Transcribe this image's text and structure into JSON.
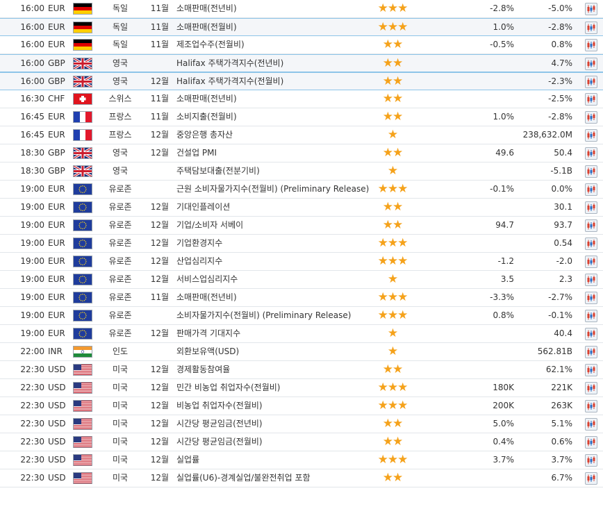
{
  "colors": {
    "star": "#f5a21b",
    "highlight_border": "#8dc4e8",
    "row_border": "#e2e6ea"
  },
  "star_glyph": "★",
  "chart_icon": "candlestick-chart-icon",
  "rows": [
    {
      "time": "16:00",
      "currency": "EUR",
      "flag": "de",
      "country": "독일",
      "period": "11월",
      "event": "소매판매(전년비)",
      "importance": 3,
      "forecast": "-2.8%",
      "previous": "-5.0%",
      "highlight": false
    },
    {
      "time": "16:00",
      "currency": "EUR",
      "flag": "de",
      "country": "독일",
      "period": "11월",
      "event": "소매판매(전월비)",
      "importance": 3,
      "forecast": "1.0%",
      "previous": "-2.8%",
      "highlight": true
    },
    {
      "time": "16:00",
      "currency": "EUR",
      "flag": "de",
      "country": "독일",
      "period": "11월",
      "event": "제조업수주(전월비)",
      "importance": 2,
      "forecast": "-0.5%",
      "previous": "0.8%",
      "highlight": false
    },
    {
      "time": "16:00",
      "currency": "GBP",
      "flag": "gb",
      "country": "영국",
      "period": "",
      "event": "Halifax 주택가격지수(전년비)",
      "importance": 2,
      "forecast": "",
      "previous": "4.7%",
      "highlight": true
    },
    {
      "time": "16:00",
      "currency": "GBP",
      "flag": "gb",
      "country": "영국",
      "period": "12월",
      "event": "Halifax 주택가격지수(전월비)",
      "importance": 2,
      "forecast": "",
      "previous": "-2.3%",
      "highlight": true
    },
    {
      "time": "16:30",
      "currency": "CHF",
      "flag": "ch",
      "country": "스위스",
      "period": "11월",
      "event": "소매판매(전년비)",
      "importance": 2,
      "forecast": "",
      "previous": "-2.5%",
      "highlight": false
    },
    {
      "time": "16:45",
      "currency": "EUR",
      "flag": "fr",
      "country": "프랑스",
      "period": "11월",
      "event": "소비지출(전월비)",
      "importance": 2,
      "forecast": "1.0%",
      "previous": "-2.8%",
      "highlight": false
    },
    {
      "time": "16:45",
      "currency": "EUR",
      "flag": "fr",
      "country": "프랑스",
      "period": "12월",
      "event": "중앙은행 총자산",
      "importance": 1,
      "forecast": "",
      "previous": "238,632.0M",
      "highlight": false
    },
    {
      "time": "18:30",
      "currency": "GBP",
      "flag": "gb",
      "country": "영국",
      "period": "12월",
      "event": "건설업 PMI",
      "importance": 2,
      "forecast": "49.6",
      "previous": "50.4",
      "highlight": false
    },
    {
      "time": "18:30",
      "currency": "GBP",
      "flag": "gb",
      "country": "영국",
      "period": "",
      "event": "주택담보대출(전분기비)",
      "importance": 1,
      "forecast": "",
      "previous": "-5.1B",
      "highlight": false
    },
    {
      "time": "19:00",
      "currency": "EUR",
      "flag": "eu",
      "country": "유로존",
      "period": "",
      "event": "근원 소비자물가지수(전월비) (Preliminary Release)",
      "importance": 3,
      "forecast": "-0.1%",
      "previous": "0.0%",
      "highlight": false
    },
    {
      "time": "19:00",
      "currency": "EUR",
      "flag": "eu",
      "country": "유로존",
      "period": "12월",
      "event": "기대인플레이션",
      "importance": 2,
      "forecast": "",
      "previous": "30.1",
      "highlight": false
    },
    {
      "time": "19:00",
      "currency": "EUR",
      "flag": "eu",
      "country": "유로존",
      "period": "12월",
      "event": "기업/소비자 서베이",
      "importance": 2,
      "forecast": "94.7",
      "previous": "93.7",
      "highlight": false
    },
    {
      "time": "19:00",
      "currency": "EUR",
      "flag": "eu",
      "country": "유로존",
      "period": "12월",
      "event": "기업환경지수",
      "importance": 3,
      "forecast": "",
      "previous": "0.54",
      "highlight": false
    },
    {
      "time": "19:00",
      "currency": "EUR",
      "flag": "eu",
      "country": "유로존",
      "period": "12월",
      "event": "산업심리지수",
      "importance": 3,
      "forecast": "-1.2",
      "previous": "-2.0",
      "highlight": false
    },
    {
      "time": "19:00",
      "currency": "EUR",
      "flag": "eu",
      "country": "유로존",
      "period": "12월",
      "event": "서비스업심리지수",
      "importance": 1,
      "forecast": "3.5",
      "previous": "2.3",
      "highlight": false
    },
    {
      "time": "19:00",
      "currency": "EUR",
      "flag": "eu",
      "country": "유로존",
      "period": "11월",
      "event": "소매판매(전년비)",
      "importance": 3,
      "forecast": "-3.3%",
      "previous": "-2.7%",
      "highlight": false
    },
    {
      "time": "19:00",
      "currency": "EUR",
      "flag": "eu",
      "country": "유로존",
      "period": "",
      "event": "소비자물가지수(전월비) (Preliminary Release)",
      "importance": 3,
      "forecast": "0.8%",
      "previous": "-0.1%",
      "highlight": false
    },
    {
      "time": "19:00",
      "currency": "EUR",
      "flag": "eu",
      "country": "유로존",
      "period": "12월",
      "event": "판매가격 기대지수",
      "importance": 1,
      "forecast": "",
      "previous": "40.4",
      "highlight": false
    },
    {
      "time": "22:00",
      "currency": "INR",
      "flag": "in",
      "country": "인도",
      "period": "",
      "event": "외환보유액(USD)",
      "importance": 1,
      "forecast": "",
      "previous": "562.81B",
      "highlight": false
    },
    {
      "time": "22:30",
      "currency": "USD",
      "flag": "us",
      "country": "미국",
      "period": "12월",
      "event": "경제활동참여율",
      "importance": 2,
      "forecast": "",
      "previous": "62.1%",
      "highlight": false
    },
    {
      "time": "22:30",
      "currency": "USD",
      "flag": "us",
      "country": "미국",
      "period": "12월",
      "event": "민간 비농업 취업자수(전월비)",
      "importance": 3,
      "forecast": "180K",
      "previous": "221K",
      "highlight": false
    },
    {
      "time": "22:30",
      "currency": "USD",
      "flag": "us",
      "country": "미국",
      "period": "12월",
      "event": "비농업 취업자수(전월비)",
      "importance": 3,
      "forecast": "200K",
      "previous": "263K",
      "highlight": false
    },
    {
      "time": "22:30",
      "currency": "USD",
      "flag": "us",
      "country": "미국",
      "period": "12월",
      "event": "시간당 평균임금(전년비)",
      "importance": 2,
      "forecast": "5.0%",
      "previous": "5.1%",
      "highlight": false
    },
    {
      "time": "22:30",
      "currency": "USD",
      "flag": "us",
      "country": "미국",
      "period": "12월",
      "event": "시간당 평균임금(전월비)",
      "importance": 2,
      "forecast": "0.4%",
      "previous": "0.6%",
      "highlight": false
    },
    {
      "time": "22:30",
      "currency": "USD",
      "flag": "us",
      "country": "미국",
      "period": "12월",
      "event": "실업률",
      "importance": 3,
      "forecast": "3.7%",
      "previous": "3.7%",
      "highlight": false
    },
    {
      "time": "22:30",
      "currency": "USD",
      "flag": "us",
      "country": "미국",
      "period": "12월",
      "event": "실업률(U6)-경계실업/불완전취업 포함",
      "importance": 2,
      "forecast": "",
      "previous": "6.7%",
      "highlight": false
    }
  ]
}
